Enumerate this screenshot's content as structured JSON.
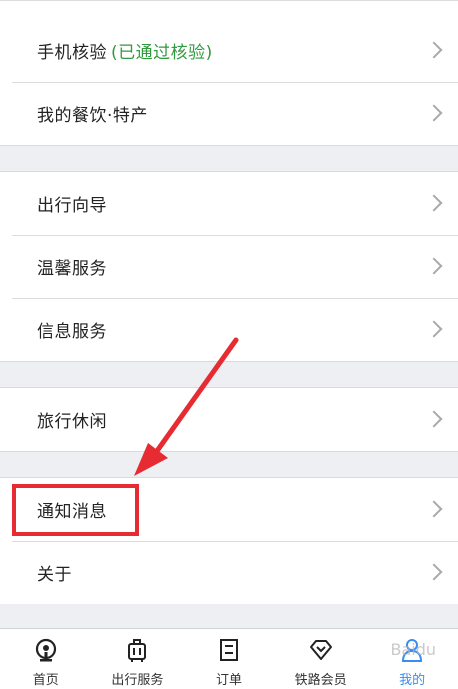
{
  "menu": {
    "group1": [
      {
        "label": "手机核验",
        "status": "(已通过核验)"
      },
      {
        "label": "我的餐饮·特产"
      }
    ],
    "group2": [
      {
        "label": "出行向导"
      },
      {
        "label": "温馨服务"
      },
      {
        "label": "信息服务"
      }
    ],
    "group3": [
      {
        "label": "旅行休闲"
      }
    ],
    "group4": [
      {
        "label": "通知消息"
      },
      {
        "label": "关于"
      }
    ]
  },
  "tabbar": {
    "home": "首页",
    "travel": "出行服务",
    "orders": "订单",
    "member": "铁路会员",
    "mine": "我的"
  },
  "watermark": "Baidu",
  "colors": {
    "accent": "#3a8df0",
    "status_green": "#2f9a3e",
    "annotation_red": "#e62b32"
  }
}
